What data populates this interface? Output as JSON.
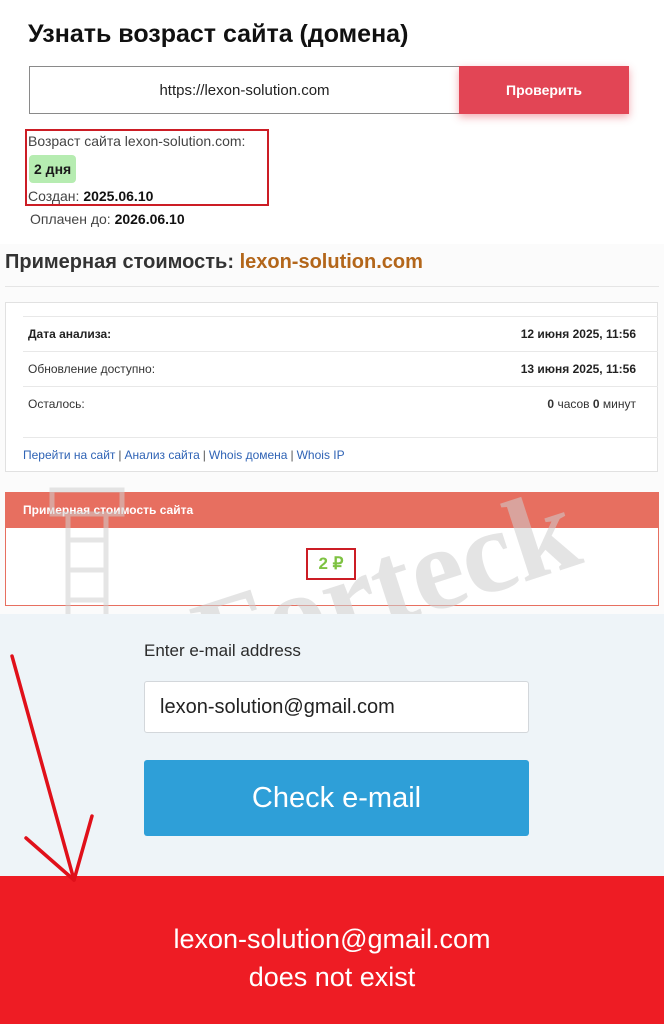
{
  "age_check": {
    "title": "Узнать возраст сайта (домена)",
    "url_value": "https://lexon-solution.com",
    "check_button": "Проверить",
    "age_label": "Возраст сайта lexon-solution.com:",
    "age_value": "2 дня",
    "created_label": "Создан:",
    "created_value": "2025.06.10",
    "paid_label": "Оплачен до:",
    "paid_value": "2026.06.10"
  },
  "cost": {
    "heading_prefix": "Примерная стоимость",
    "heading_colon": ":",
    "heading_domain": "lexon-solution.com",
    "rows": [
      {
        "label": "Дата анализа:",
        "value_main": "12 июня 2025, 11:56"
      },
      {
        "label": "Обновление доступно:",
        "value_main": "13 июня 2025, 11:56"
      },
      {
        "label": "Осталось:",
        "hours": "0",
        "hours_unit": "часов",
        "minutes": "0",
        "minutes_unit": "минут"
      }
    ],
    "links": [
      "Перейти на сайт",
      "Анализ сайта",
      "Whois домена",
      "Whois IP"
    ],
    "link_separator": "|",
    "price_header": "Примерная стоимость сайта",
    "price_value": "2 ₽"
  },
  "watermark": {
    "text": "Forteck"
  },
  "email_check": {
    "label": "Enter e-mail address",
    "email_value": "lexon-solution@gmail.com",
    "button": "Check e-mail",
    "result_line1": "lexon-solution@gmail.com",
    "result_line2": "does not exist"
  },
  "colors": {
    "accent_red": "#e24555",
    "highlight_border": "#cc1d25",
    "badge_green": "#b6ecb1",
    "domain_orange": "#b3661a",
    "price_header": "#e76f60",
    "price_green": "#7ec242",
    "email_button": "#2e9fd8",
    "result_banner": "#ee1c24"
  }
}
